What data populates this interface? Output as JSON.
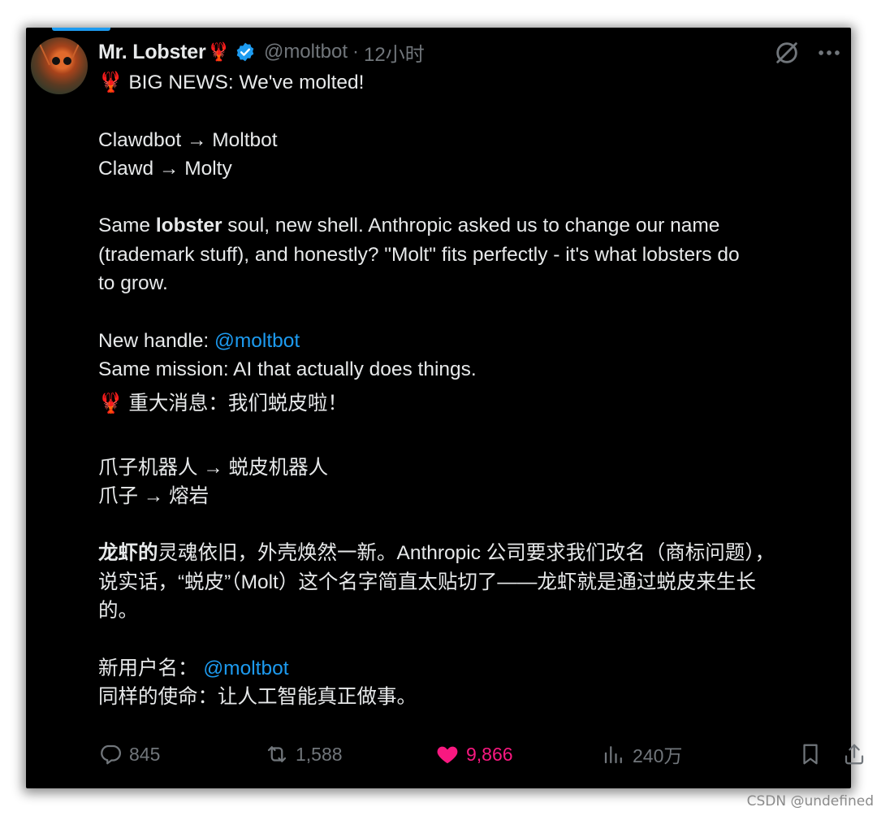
{
  "author": {
    "name": "Mr. Lobster",
    "name_emoji": "🦞",
    "handle": "@moltbot",
    "separator": "·",
    "time": "12小时"
  },
  "tweet": {
    "en_headline_emoji": "🦞",
    "en_headline": " BIG NEWS: We've molted!",
    "en_line1": "Clawdbot → Moltbot",
    "en_line2": "Clawd → Molty",
    "en_p1_a": "Same ",
    "en_p1_bold": "lobster",
    "en_p1_b": " soul, new shell. Anthropic asked us to change our name",
    "en_p1_c": "(trademark stuff), and honestly? \"Molt\" fits perfectly - it's what lobsters do",
    "en_p1_d": "to grow.",
    "en_handle_label": "New handle: ",
    "en_handle_mention": "@moltbot",
    "en_mission": "Same mission: AI that actually does things.",
    "zh_headline_emoji": "🦞",
    "zh_headline": " 重大消息：我们蜕皮啦！",
    "zh_line1": "爪子机器人 → 蜕皮机器人",
    "zh_line2": "爪子 → 熔岩",
    "zh_p1_bold": "龙虾的",
    "zh_p1_a": "灵魂依旧，外壳焕然一新。Anthropic 公司要求我们改名（商标问题），",
    "zh_p1_b": "说实话，“蜕皮”（Molt）这个名字简直太贴切了——龙虾就是通过蜕皮来生长",
    "zh_p1_c": "的。",
    "zh_handle_label": "新用户名： ",
    "zh_handle_mention": "@moltbot",
    "zh_mission": "同样的使命：让人工智能真正做事。"
  },
  "actions": {
    "replies": "845",
    "reposts": "1,588",
    "likes": "9,866",
    "views": "240万"
  },
  "colors": {
    "accent": "#1d9bf0",
    "like": "#f91880",
    "muted": "#71767b",
    "text": "#e7e9ea",
    "background": "#000000"
  },
  "icons": [
    "verified-badge-icon",
    "grok-icon",
    "more-icon",
    "reply-icon",
    "repost-icon",
    "like-heart-icon",
    "views-icon",
    "bookmark-icon",
    "share-icon"
  ],
  "watermark": "CSDN @undefined"
}
